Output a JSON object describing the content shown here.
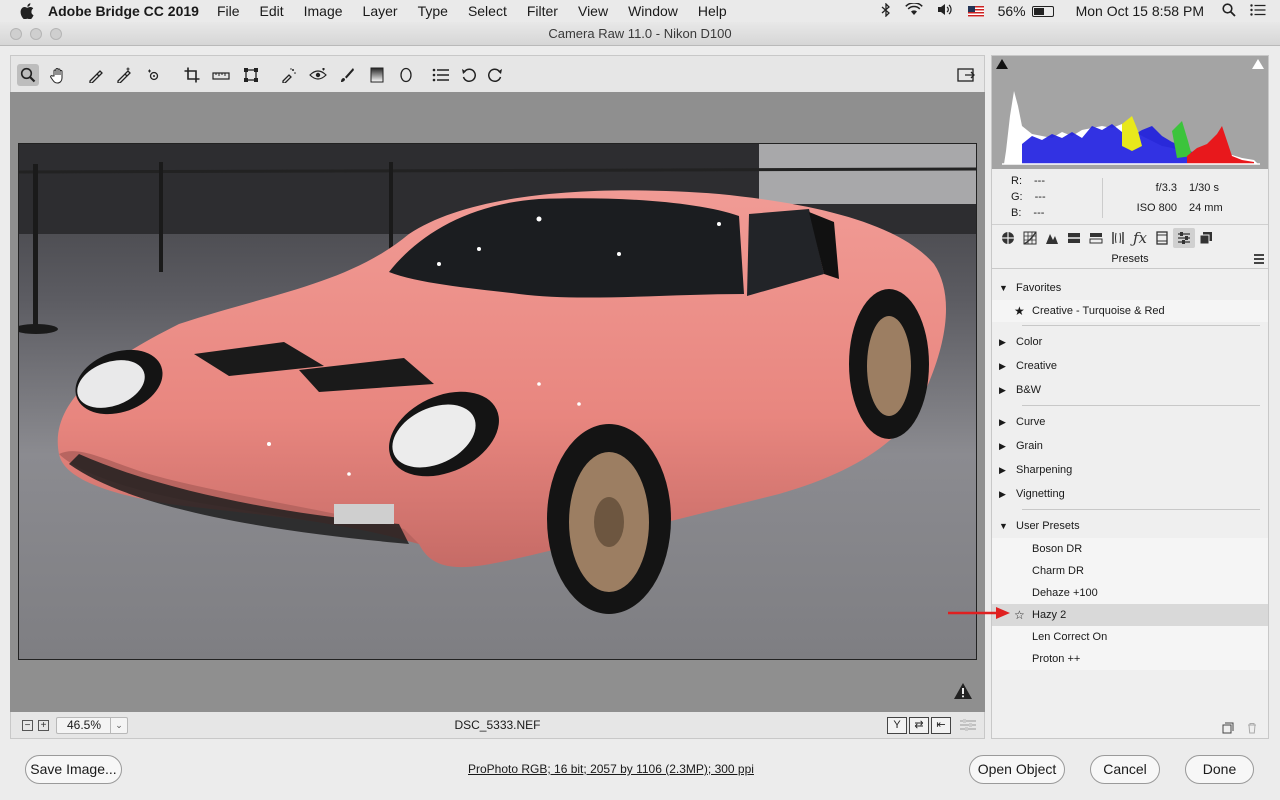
{
  "menubar": {
    "app_name": "Adobe Bridge CC 2019",
    "menus": [
      "File",
      "Edit",
      "Image",
      "Layer",
      "Type",
      "Select",
      "Filter",
      "View",
      "Window",
      "Help"
    ],
    "battery": "56%",
    "clock": "Mon Oct 15  8:58 PM"
  },
  "window": {
    "title": "Camera Raw 11.0  -  Nikon D100"
  },
  "toolbar": {
    "tools": [
      "zoom-icon",
      "hand-icon",
      "white-balance-icon",
      "color-sampler-icon",
      "targeted-adjustment-icon",
      "crop-icon",
      "straighten-icon",
      "transform-icon",
      "spot-removal-icon",
      "red-eye-icon",
      "adjustment-brush-icon",
      "graduated-filter-icon",
      "radial-filter-icon",
      "presets-list-icon",
      "rotate-ccw-icon",
      "rotate-cw-icon"
    ],
    "active_tool": "zoom-icon"
  },
  "status": {
    "zoom": "46.5%",
    "filename": "DSC_5333.NEF",
    "view_buttons": [
      "Y",
      "⇄",
      "⇤"
    ]
  },
  "readout": {
    "r_label": "R:",
    "r_value": "---",
    "g_label": "G:",
    "g_value": "---",
    "b_label": "B:",
    "b_value": "---",
    "aperture": "f/3.3",
    "shutter": "1/30 s",
    "iso": "ISO 800",
    "focal": "24 mm"
  },
  "panel": {
    "title": "Presets",
    "tab_icons": [
      "basic-icon",
      "tone-curve-icon",
      "detail-icon",
      "hsl-icon",
      "split-toning-icon",
      "lens-icon",
      "effects-icon",
      "calibration-icon",
      "presets-icon",
      "snapshots-icon"
    ],
    "groups": {
      "favorites": {
        "label": "Favorites",
        "items": [
          "Creative - Turquoise & Red"
        ]
      },
      "color": "Color",
      "creative": "Creative",
      "bw": "B&W",
      "curve": "Curve",
      "grain": "Grain",
      "sharpening": "Sharpening",
      "vignetting": "Vignetting",
      "user": {
        "label": "User Presets",
        "items": [
          "Boson DR",
          "Charm DR",
          "Dehaze +100",
          "Hazy 2",
          "Len Correct On",
          "Proton ++"
        ]
      }
    },
    "selected_item": "Hazy 2"
  },
  "footer": {
    "save_label": "Save Image...",
    "info_text": "ProPhoto RGB; 16 bit; 2057 by 1106 (2.3MP); 300 ppi",
    "open_label": "Open Object",
    "cancel_label": "Cancel",
    "done_label": "Done"
  },
  "colors": {
    "arrow": "#e02020",
    "car_body": "#e88a86",
    "histogram_red": "#e8181c",
    "histogram_green": "#3cc43c",
    "histogram_blue": "#1c1ce0",
    "histogram_yellow": "#e8e81c"
  }
}
